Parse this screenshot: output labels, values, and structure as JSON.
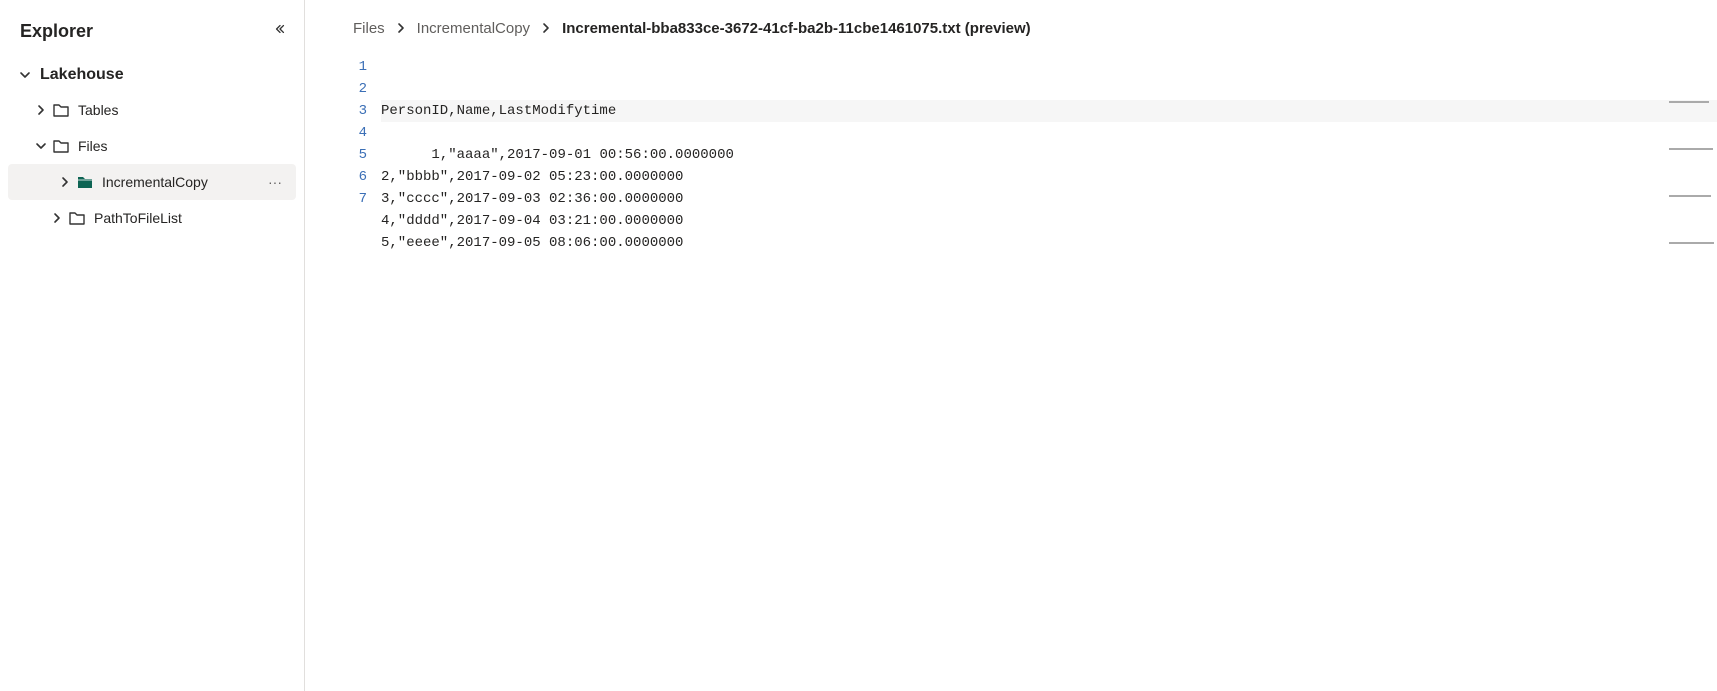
{
  "sidebar": {
    "title": "Explorer",
    "section": {
      "label": "Lakehouse"
    },
    "tree": {
      "tables": {
        "label": "Tables"
      },
      "files": {
        "label": "Files"
      },
      "incremental": {
        "label": "IncrementalCopy"
      },
      "pathToFileList": {
        "label": "PathToFileList"
      }
    }
  },
  "breadcrumb": {
    "item0": "Files",
    "item1": "IncrementalCopy",
    "item2": "Incremental-bba833ce-3672-41cf-ba2b-11cbe1461075.txt (preview)"
  },
  "code": {
    "line1": "PersonID,Name,LastModifytime",
    "line2": "1,\"aaaa\",2017-09-01 00:56:00.0000000",
    "line3": "2,\"bbbb\",2017-09-02 05:23:00.0000000",
    "line4": "3,\"cccc\",2017-09-03 02:36:00.0000000",
    "line5": "4,\"dddd\",2017-09-04 03:21:00.0000000",
    "line6": "5,\"eeee\",2017-09-05 08:06:00.0000000",
    "line7": ""
  },
  "lineNums": {
    "n1": "1",
    "n2": "2",
    "n3": "3",
    "n4": "4",
    "n5": "5",
    "n6": "6",
    "n7": "7"
  },
  "icons": {
    "ellipsis": "···"
  }
}
